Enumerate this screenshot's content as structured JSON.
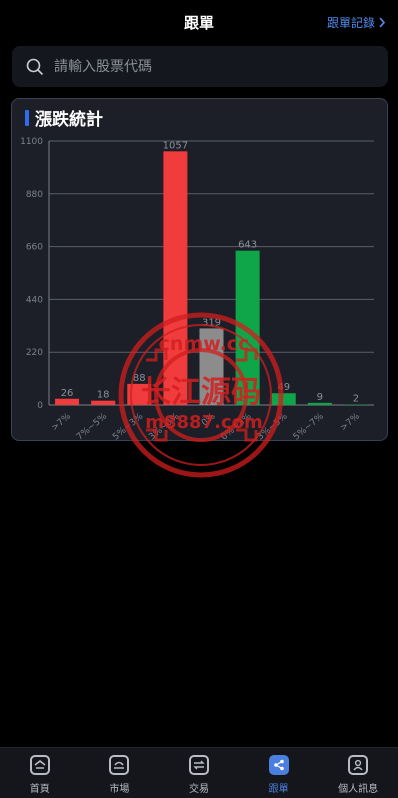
{
  "header": {
    "title": "跟單",
    "record_label": "跟單記錄"
  },
  "search": {
    "placeholder": "請輸入股票代碼"
  },
  "card": {
    "title": "漲跌統計"
  },
  "chart_data": {
    "type": "bar",
    "categories": [
      ">7%",
      "7%~5%",
      "5%~3%",
      "3%~0%",
      "0%",
      "0%~3%",
      "3%~5%",
      "5%~7%",
      ">7%"
    ],
    "values": [
      26,
      18,
      88,
      1057,
      319,
      643,
      49,
      9,
      2
    ],
    "colors": [
      "#f03c3c",
      "#f03c3c",
      "#f03c3c",
      "#f03c3c",
      "#8c8c8c",
      "#0fa64a",
      "#0fa64a",
      "#0fa64a",
      "#0fa64a"
    ],
    "ylim": [
      0,
      1100
    ],
    "yticks": [
      0,
      220,
      440,
      660,
      880,
      1100
    ],
    "grid": true
  },
  "watermark": {
    "line1": "cnmw.cc",
    "line2": "长江源码",
    "line3": "m8887.com",
    "color": "#d21e1e"
  },
  "tabbar": {
    "items": [
      {
        "label": "首頁",
        "icon": "home-icon"
      },
      {
        "label": "市場",
        "icon": "market-icon"
      },
      {
        "label": "交易",
        "icon": "trade-icon"
      },
      {
        "label": "跟單",
        "icon": "share-icon",
        "active": true
      },
      {
        "label": "個人訊息",
        "icon": "user-icon"
      }
    ]
  }
}
